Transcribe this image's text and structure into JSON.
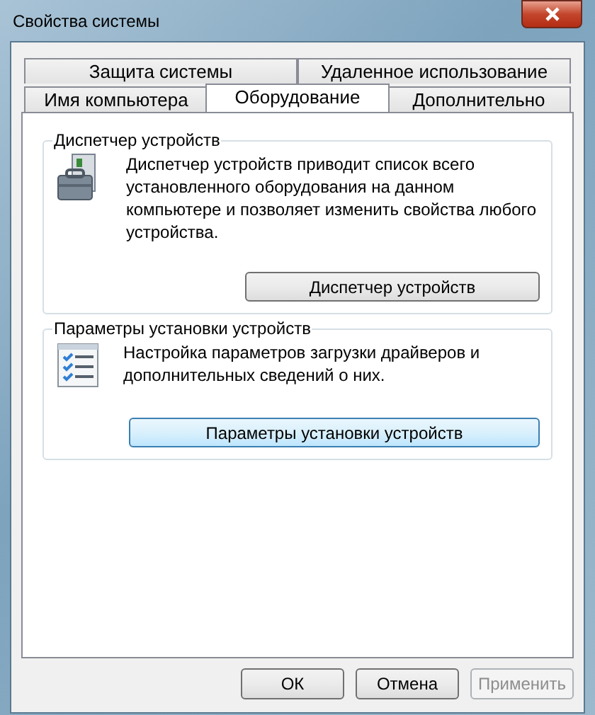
{
  "window": {
    "title": "Свойства системы"
  },
  "tab_rows": [
    [
      {
        "label": "Защита системы",
        "selected": false
      },
      {
        "label": "Удаленное использование",
        "selected": false
      }
    ],
    [
      {
        "label": "Имя компьютера",
        "selected": false
      },
      {
        "label": "Оборудование",
        "selected": true
      },
      {
        "label": "Дополнительно",
        "selected": false
      }
    ]
  ],
  "groups": [
    {
      "title": "Диспетчер устройств",
      "kind": "device-manager",
      "text": "Диспетчер устройств приводит список всего установленного оборудования на данном компьютере и позволяет изменить свойства любого устройства.",
      "button": {
        "label": "Диспетчер устройств",
        "focused": false
      }
    },
    {
      "title": "Параметры установки устройств",
      "kind": "install-settings",
      "text": "Настройка параметров загрузки драйверов и дополнительных сведений о них.",
      "button": {
        "label": "Параметры установки устройств",
        "focused": true
      }
    }
  ],
  "buttons": [
    {
      "label": "ОК",
      "disabled": false
    },
    {
      "label": "Отмена",
      "disabled": false
    },
    {
      "label": "Применить",
      "disabled": true
    }
  ]
}
